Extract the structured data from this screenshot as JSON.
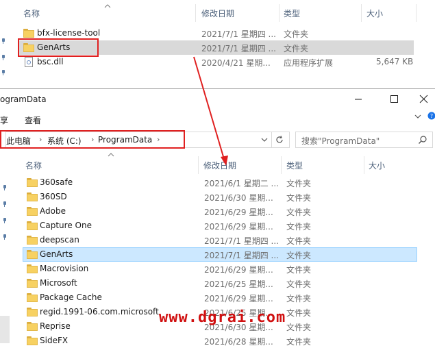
{
  "top_window": {
    "columns": {
      "name": "名称",
      "date": "修改日期",
      "type": "类型",
      "size": "大小"
    },
    "rows": [
      {
        "name": "bfx-license-tool",
        "date": "2021/7/1 星期四 ...",
        "type": "文件夹",
        "size": "",
        "icon": "folder-icon"
      },
      {
        "name": "GenArts",
        "date": "2021/7/1 星期四 ...",
        "type": "文件夹",
        "size": "",
        "icon": "folder-icon",
        "highlighted": true
      },
      {
        "name": "bsc.dll",
        "date": "2020/4/21 星期...",
        "type": "应用程序扩展",
        "size": "5,647 KB",
        "icon": "dll-file-icon"
      }
    ]
  },
  "bottom_window": {
    "title": "ogramData",
    "title_buttons": {
      "minimize": "—",
      "maximize": "☐",
      "close": "✕"
    },
    "ribbon": {
      "file_tab": "享",
      "view_tab": "查看"
    },
    "address": {
      "crumbs": [
        "此电脑",
        "系统 (C:)",
        "ProgramData"
      ]
    },
    "search_placeholder": "搜索\"ProgramData\"",
    "columns": {
      "name": "名称",
      "date": "修改日期",
      "type": "类型",
      "size": "大小"
    },
    "rows": [
      {
        "name": "360safe",
        "date": "2021/6/1 星期二 ...",
        "type": "文件夹"
      },
      {
        "name": "360SD",
        "date": "2021/6/30 星期...",
        "type": "文件夹"
      },
      {
        "name": "Adobe",
        "date": "2021/6/29 星期...",
        "type": "文件夹"
      },
      {
        "name": "Capture One",
        "date": "2021/6/29 星期...",
        "type": "文件夹"
      },
      {
        "name": "deepscan",
        "date": "2021/7/1 星期四 ...",
        "type": "文件夹"
      },
      {
        "name": "GenArts",
        "date": "2021/7/1 星期四 ...",
        "type": "文件夹",
        "selected": true
      },
      {
        "name": "Macrovision",
        "date": "2021/6/29 星期...",
        "type": "文件夹"
      },
      {
        "name": "Microsoft",
        "date": "2021/6/25 星期...",
        "type": "文件夹"
      },
      {
        "name": "Package Cache",
        "date": "2021/6/29 星期...",
        "type": "文件夹"
      },
      {
        "name": "regid.1991-06.com.microsoft",
        "date": "2021/6/25 星期...",
        "type": "文件夹"
      },
      {
        "name": "Reprise",
        "date": "2021/6/30 星期...",
        "type": "文件夹"
      },
      {
        "name": "SideFX",
        "date": "2021/6/28 星期...",
        "type": "文件夹"
      }
    ]
  },
  "watermark": "www.dgrai.com",
  "colors": {
    "annotation_red": "#e02020",
    "selection_blue": "#cce8ff",
    "folder_yellow": "#f7d162",
    "highlight_gray": "#d9d9d9"
  }
}
